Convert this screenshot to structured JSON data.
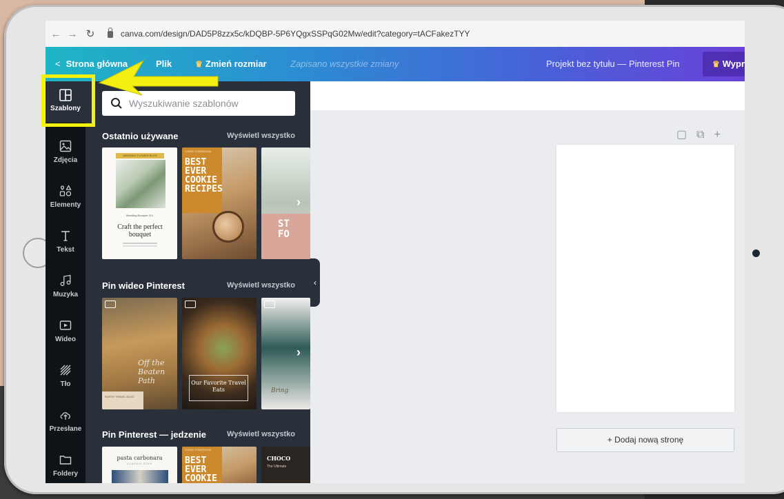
{
  "browser": {
    "url": "canva.com/design/DAD5P8zzx5c/kDQBP-5P6YQgxSSPqG02Mw/edit?category=tACFakezTYY"
  },
  "topbar": {
    "back_label": "Strona główna",
    "file_label": "Plik",
    "resize_label": "Zmień rozmiar",
    "saved_status": "Zapisano wszystkie zmiany",
    "project_title": "Projekt bez tytułu — Pinterest Pin",
    "upgrade_label": "Wypr"
  },
  "rail": {
    "items": [
      {
        "label": "Szablony",
        "icon": "layout-icon"
      },
      {
        "label": "Zdjęcia",
        "icon": "image-icon"
      },
      {
        "label": "Elementy",
        "icon": "shapes-icon"
      },
      {
        "label": "Tekst",
        "icon": "text-icon"
      },
      {
        "label": "Muzyka",
        "icon": "music-icon"
      },
      {
        "label": "Wideo",
        "icon": "video-icon"
      },
      {
        "label": "Tło",
        "icon": "pattern-icon"
      },
      {
        "label": "Przesłane",
        "icon": "upload-cloud-icon"
      },
      {
        "label": "Foldery",
        "icon": "folder-icon"
      }
    ]
  },
  "panel": {
    "search_placeholder": "Wyszukiwanie szablonów",
    "sections": [
      {
        "title": "Ostatnio używane",
        "link": "Wyświetl wszystko"
      },
      {
        "title": "Pin wideo Pinterest",
        "link": "Wyświetl wszystko"
      },
      {
        "title": "Pin Pinterest — jedzenie",
        "link": "Wyświetl wszystko"
      }
    ],
    "thumbs": {
      "bouquet_header": "WEDDING FLOWER BLOG",
      "bouquet_kicker": "Wedding Bouquet 101",
      "bouquet_title": "Craft the perfect bouquet",
      "cookie_kicker": "COOKIE COUNTDOWN",
      "cookie_title": "BEST EVER COOKIE RECIPES",
      "cookie_title_short": "BEST EVER COOKIE",
      "recent_third": "ST FO",
      "travel_script": "Off the Beaten Path",
      "travel_footer": "NORTH TRAVEL BLOG",
      "food_caption": "Our Favorite Travel Eats",
      "bring_script": "Bring",
      "pasta_title": "pasta carbonara",
      "pasta_sub": "CLASSIC DISH",
      "choc_title": "CHOCO",
      "choc_sub": "The Ultimate"
    }
  },
  "canvas": {
    "add_page_label": "+ Dodaj nową stronę"
  },
  "colors": {
    "highlight": "#f4f10e",
    "rail_bg": "#0e1318",
    "panel_bg": "#293039"
  }
}
